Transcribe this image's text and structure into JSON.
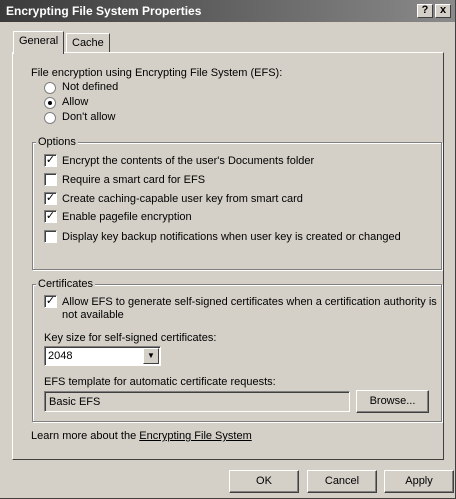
{
  "window": {
    "title": "Encrypting File System Properties",
    "help_label": "?",
    "close_label": "x"
  },
  "tabs": [
    {
      "label": "General",
      "active": true
    },
    {
      "label": "Cache",
      "active": false
    }
  ],
  "efs": {
    "label": "File encryption using Encrypting File System (EFS):",
    "options": [
      {
        "label": "Not defined",
        "selected": false
      },
      {
        "label": "Allow",
        "selected": true
      },
      {
        "label": "Don't allow",
        "selected": false
      }
    ]
  },
  "options": {
    "title": "Options",
    "items": [
      {
        "label": "Encrypt the contents of the user's Documents folder",
        "checked": true
      },
      {
        "label": "Require a smart card for EFS",
        "checked": false
      },
      {
        "label": "Create caching-capable user key from smart card",
        "checked": true
      },
      {
        "label": "Enable pagefile encryption",
        "checked": true
      },
      {
        "label": "Display key backup notifications when user key is created or changed",
        "checked": false
      }
    ]
  },
  "certificates": {
    "title": "Certificates",
    "allow_self_signed": {
      "line1": "Allow EFS to generate self-signed certificates when a certification authority is",
      "line2": "not available",
      "checked": true
    },
    "key_size_label": "Key size for self-signed certificates:",
    "key_size_value": "2048",
    "template_label": "EFS template for automatic certificate requests:",
    "template_value": "Basic EFS",
    "browse_label": "Browse..."
  },
  "footer": {
    "learn_prefix": "Learn more about the ",
    "learn_link": "Encrypting File System"
  },
  "buttons": {
    "ok": "OK",
    "cancel": "Cancel",
    "apply": "Apply"
  },
  "check_glyph": "✓"
}
